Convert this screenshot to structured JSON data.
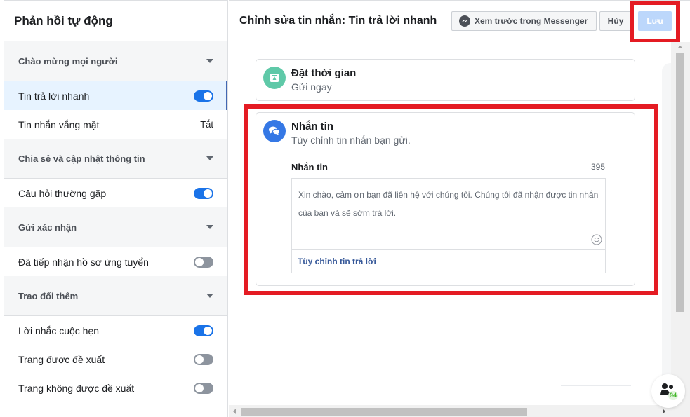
{
  "sidebar": {
    "title": "Phản hồi tự động",
    "sections": [
      {
        "header": "Chào mừng mọi người",
        "items": [
          {
            "label": "Tin trả lời nhanh",
            "toggle": "on",
            "active": true
          },
          {
            "label": "Tin nhắn vắng mặt",
            "value": "Tắt"
          }
        ]
      },
      {
        "header": "Chia sẻ và cập nhật thông tin",
        "items": [
          {
            "label": "Câu hỏi thường gặp",
            "toggle": "on"
          }
        ]
      },
      {
        "header": "Gửi xác nhận",
        "items": [
          {
            "label": "Đã tiếp nhận hồ sơ ứng tuyển",
            "toggle": "off"
          }
        ]
      },
      {
        "header": "Trao đổi thêm",
        "items": [
          {
            "label": "Lời nhắc cuộc hẹn",
            "toggle": "on"
          },
          {
            "label": "Trang được đề xuất",
            "toggle": "off"
          },
          {
            "label": "Trang không được đề xuất",
            "toggle": "off"
          }
        ]
      }
    ]
  },
  "header": {
    "title": "Chỉnh sửa tin nhắn: Tin trả lời nhanh",
    "preview_label": "Xem trước trong Messenger",
    "cancel_label": "Hủy",
    "save_label": "Lưu"
  },
  "schedule_card": {
    "title": "Đặt thời gian",
    "subtitle": "Gửi ngay"
  },
  "message_card": {
    "title": "Nhắn tin",
    "subtitle": "Tùy chỉnh tin nhắn bạn gửi.",
    "field_label": "Nhắn tin",
    "char_count": "395",
    "message_text": "Xin chào, cảm ơn bạn đã liên hệ với chúng tôi. Chúng tôi đã nhận được tin nhắn của bạn và sẽ sớm trả lời.",
    "custom_reply_label": "Tùy chỉnh tin trả lời"
  },
  "people_fab": {
    "count": "94"
  },
  "colors": {
    "accent": "#1a73e8",
    "highlight": "#e41b23",
    "save_disabled": "#bcd7fb",
    "link": "#365899"
  }
}
